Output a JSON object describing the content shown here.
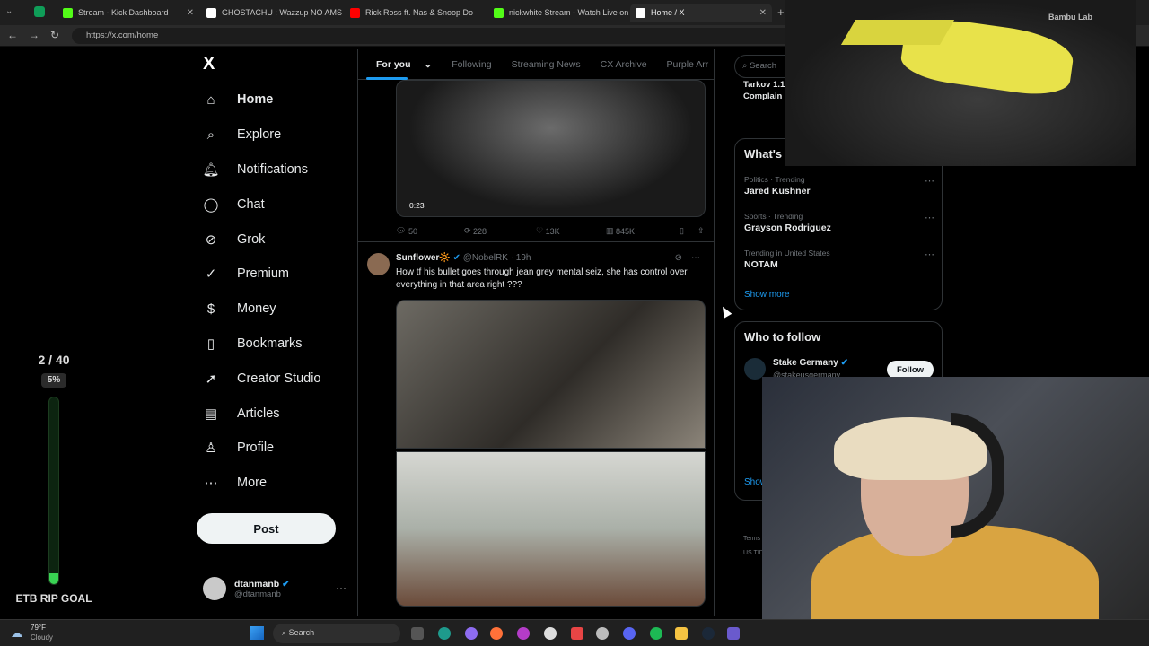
{
  "browser": {
    "tabs": [
      {
        "title": "Stream - Kick Dashboard",
        "color": "#53fc18"
      },
      {
        "title": "GHOSTACHU : Wazzup NO AMS - ",
        "color": "#ffffff"
      },
      {
        "title": "Rick Ross ft. Nas & Snoop Do",
        "color": "#ff0000"
      },
      {
        "title": "nickwhite Stream - Watch Live on",
        "color": "#53fc18"
      },
      {
        "title": "Home / X",
        "color": "#ffffff"
      }
    ],
    "url": "https://x.com/home"
  },
  "nav": {
    "logo": "X",
    "items": [
      {
        "label": "Home",
        "icon": "home-icon"
      },
      {
        "label": "Explore",
        "icon": "search-icon"
      },
      {
        "label": "Notifications",
        "icon": "bell-icon"
      },
      {
        "label": "Chat",
        "icon": "chat-icon"
      },
      {
        "label": "Grok",
        "icon": "grok-icon"
      },
      {
        "label": "Premium",
        "icon": "premium-icon"
      },
      {
        "label": "Money",
        "icon": "money-icon"
      },
      {
        "label": "Bookmarks",
        "icon": "bookmark-icon"
      },
      {
        "label": "Creator Studio",
        "icon": "rocket-icon"
      },
      {
        "label": "Articles",
        "icon": "article-icon"
      },
      {
        "label": "Profile",
        "icon": "profile-icon"
      },
      {
        "label": "More",
        "icon": "more-icon"
      }
    ],
    "post_label": "Post",
    "account": {
      "name": "dtanmanb",
      "handle": "@dtanmanb"
    }
  },
  "feed": {
    "tabs": [
      "For you",
      "Following",
      "Streaming News",
      "CX Archive",
      "Purple Arr"
    ],
    "post1": {
      "video_duration": "0:23",
      "replies": "50",
      "reposts": "228",
      "likes": "13K",
      "views": "845K"
    },
    "post2": {
      "author": "Sunflower🔆",
      "handle": "@NobelRK",
      "time": "· 19h",
      "text": "How tf his bullet goes through jean grey mental seiz, she has control over everything in that area right ???"
    }
  },
  "right": {
    "search_placeholder": "Search",
    "top_snippet": "Tarkov 1.1 Complain",
    "trends_title": "What's",
    "trends": [
      {
        "meta": "Politics · Trending",
        "name": "Jared Kushner"
      },
      {
        "meta": "Sports · Trending",
        "name": "Grayson Rodriguez"
      },
      {
        "meta": "Trending in United States",
        "name": "NOTAM"
      }
    ],
    "show_more": "Show more",
    "who_to_follow": "Who to follow",
    "suggest": {
      "name": "Stake Germany",
      "handle": "@stakeusgermany",
      "follow": "Follow"
    },
    "show_partial": "Show",
    "footer_terms": "Terms",
    "footer_us": "US TID"
  },
  "overlay": {
    "goal_progress": "2 / 40",
    "goal_percent": "5%",
    "goal_fraction": 0.05,
    "goal_label": "ETB RIP GOAL",
    "printer_brand": "Bambu Lab"
  },
  "taskbar": {
    "weather_temp": "79°F",
    "weather_desc": "Cloudy",
    "search_label": "Search"
  }
}
